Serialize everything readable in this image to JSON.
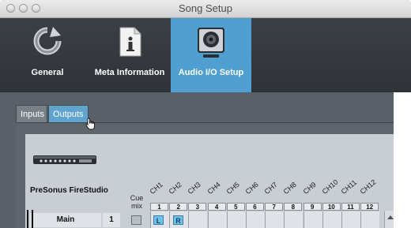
{
  "window": {
    "title": "Song Setup"
  },
  "toolbar": {
    "items": [
      {
        "label": "General",
        "icon": "refresh-icon"
      },
      {
        "label": "Meta Information",
        "icon": "document-info-icon"
      },
      {
        "label": "Audio I/O Setup",
        "icon": "audio-speaker-icon",
        "active": true
      }
    ]
  },
  "tabs": [
    {
      "label": "Inputs"
    },
    {
      "label": "Outputs",
      "active": true
    }
  ],
  "device": {
    "name": "PreSonus FireStudio"
  },
  "matrix": {
    "cue_label": "Cue mix",
    "channels": [
      "CH1",
      "CH2",
      "CH3",
      "CH4",
      "CH5",
      "CH6",
      "CH7",
      "CH8",
      "CH9",
      "CH10",
      "CH11",
      "CH12"
    ],
    "numbers": [
      "1",
      "2",
      "3",
      "4",
      "5",
      "6",
      "7",
      "8",
      "9",
      "10",
      "11",
      "12"
    ],
    "row": {
      "name": "Main",
      "number": "1",
      "assign_left": "L",
      "assign_right": "R"
    }
  },
  "colors": {
    "accent": "#4f9fd0",
    "assign": "#6fc2ea"
  }
}
